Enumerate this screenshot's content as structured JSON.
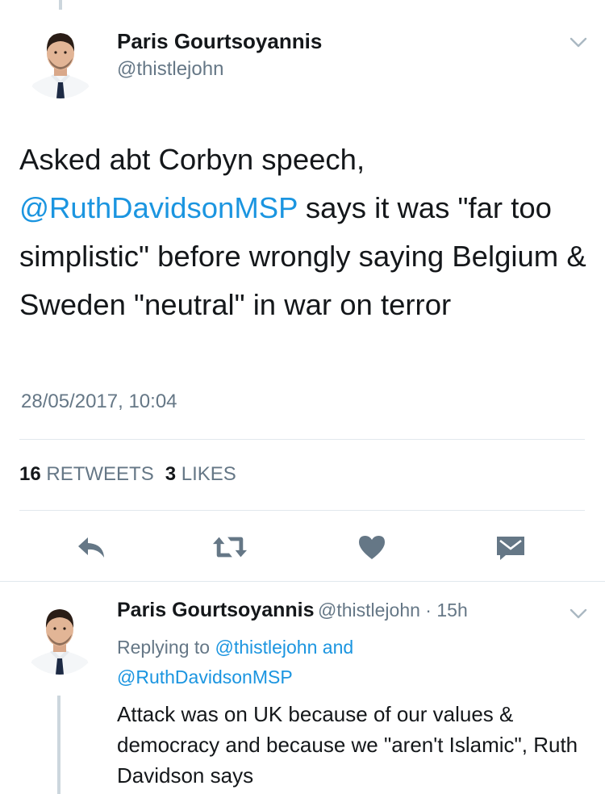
{
  "main_tweet": {
    "author_name": "Paris Gourtsoyannis",
    "author_handle": "@thistlejohn",
    "text_part1": "Asked abt Corbyn speech,",
    "text_mention": "@RuthDavidsonMSP",
    "text_part2": " says it was \"far too simplistic\" before wrongly saying Belgium & Sweden \"neutral\" in war on terror",
    "timestamp": "28/05/2017, 10:04",
    "retweets_count": "16",
    "retweets_label": "RETWEETS",
    "likes_count": "3",
    "likes_label": "LIKES"
  },
  "reply_tweet": {
    "author_name": "Paris Gourtsoyannis",
    "author_handle": "@thistlejohn",
    "separator": "·",
    "time_ago": "15h",
    "replying_prefix": "Replying to",
    "replying_mention1": "@thistlejohn",
    "replying_and": "and",
    "replying_mention2": "@RuthDavidsonMSP",
    "text": "Attack was on UK because of our values & democracy and because we \"aren't Islamic\", Ruth Davidson says"
  },
  "icons": {
    "reply": "reply-icon",
    "retweet": "retweet-icon",
    "like": "heart-icon",
    "dm": "envelope-icon",
    "menu": "chevron-down-icon"
  },
  "colors": {
    "link": "#1b95e0",
    "secondary_text": "#657786",
    "icon_grey": "#657786",
    "divider": "#e1e8ed",
    "thread_line": "#ccd6dd"
  }
}
